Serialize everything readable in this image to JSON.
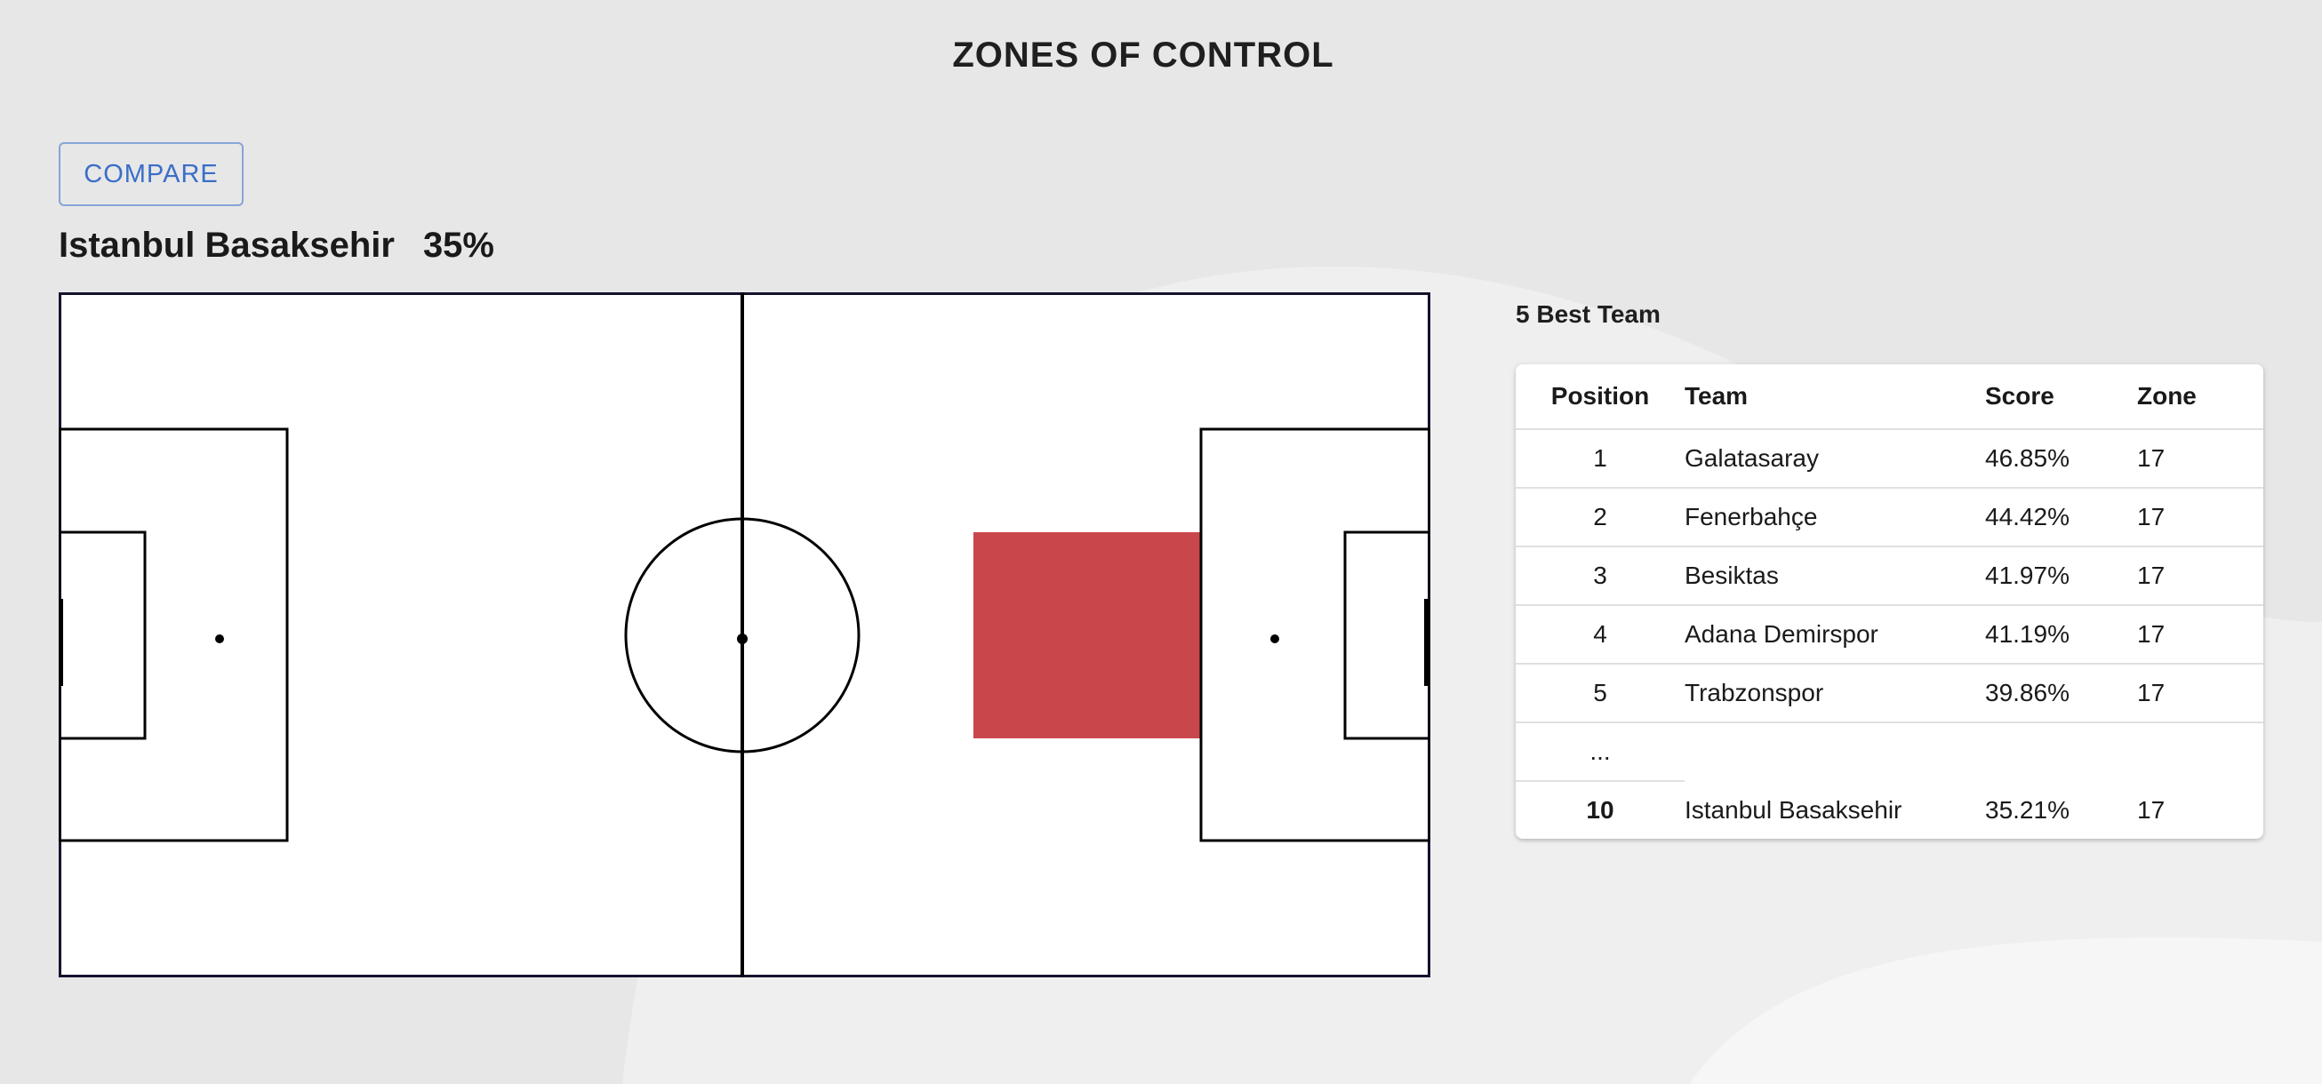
{
  "header": {
    "title": "ZONES OF CONTROL"
  },
  "toolbar": {
    "compare_label": "COMPARE"
  },
  "selected": {
    "team": "Istanbul Basaksehir",
    "percent": "35%"
  },
  "pitch": {
    "highlight_color": "#c9474b",
    "line_color": "#000000",
    "highlight_zone": {
      "column": 4,
      "row": 2,
      "columns": 6,
      "rows": 3
    }
  },
  "best": {
    "title": "5 Best Team",
    "columns": [
      "Position",
      "Team",
      "Score",
      "Zone"
    ],
    "rows": [
      {
        "position": "1",
        "team": "Galatasaray",
        "score": "46.85%",
        "zone": "17"
      },
      {
        "position": "2",
        "team": "Fenerbahçe",
        "score": "44.42%",
        "zone": "17"
      },
      {
        "position": "3",
        "team": "Besiktas",
        "score": "41.97%",
        "zone": "17"
      },
      {
        "position": "4",
        "team": "Adana Demirspor",
        "score": "41.19%",
        "zone": "17"
      },
      {
        "position": "5",
        "team": "Trabzonspor",
        "score": "39.86%",
        "zone": "17"
      }
    ],
    "ellipsis": "...",
    "current": {
      "position": "10",
      "team": "Istanbul Basaksehir",
      "score": "35.21%",
      "zone": "17"
    }
  }
}
